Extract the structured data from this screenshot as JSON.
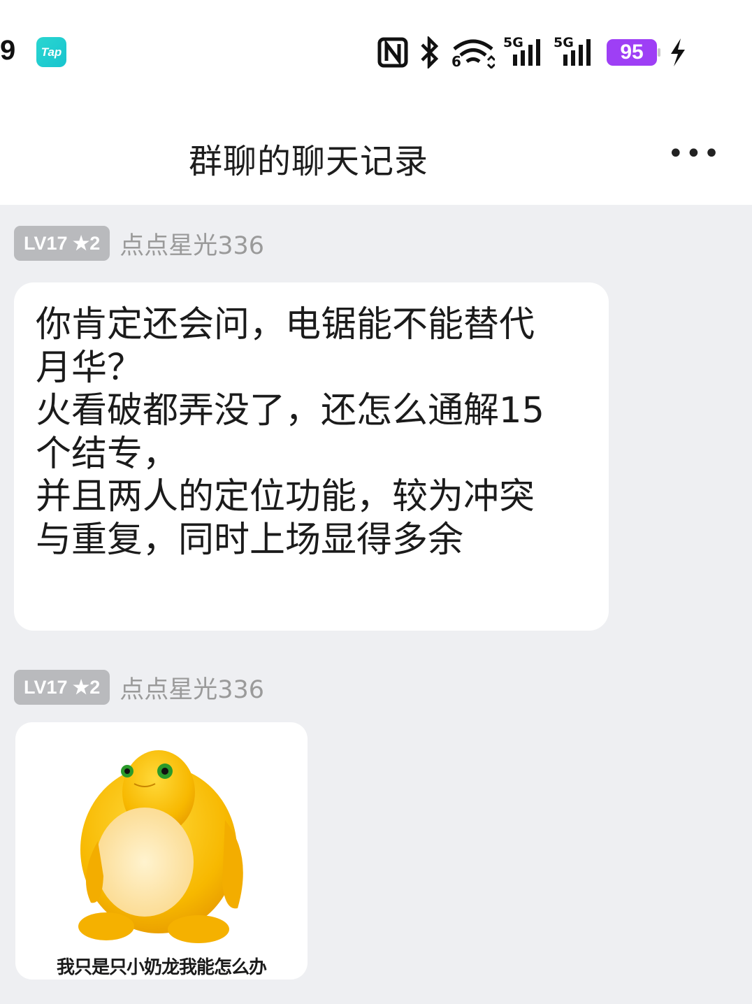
{
  "status_bar": {
    "time": "9",
    "app_icon_label": "Tap",
    "network_labels": [
      "5G",
      "5G"
    ],
    "wifi_sub": "6",
    "battery": "95",
    "icons": [
      "nfc-icon",
      "bluetooth-icon",
      "wifi-icon",
      "signal-icon",
      "signal-icon",
      "charging-icon"
    ],
    "colors": {
      "tap_icon": "#1fcfcf",
      "battery": "#9e3ff5"
    }
  },
  "header": {
    "title": "群聊的聊天记录",
    "more_label": "•••"
  },
  "messages": [
    {
      "badge": "LV17 ★2",
      "sender": "点点星光336",
      "lines": [
        "你肯定还会问，电锯能不能替代",
        "月华？",
        "",
        "火看破都弄没了，还怎么通解15",
        "个结专，",
        "并且两人的定位功能，较为冲突",
        "与重复，同时上场显得多余"
      ]
    },
    {
      "badge": "LV17 ★2",
      "sender": "点点星光336",
      "sticker_caption": "我只是只小奶龙我能怎么办"
    }
  ]
}
